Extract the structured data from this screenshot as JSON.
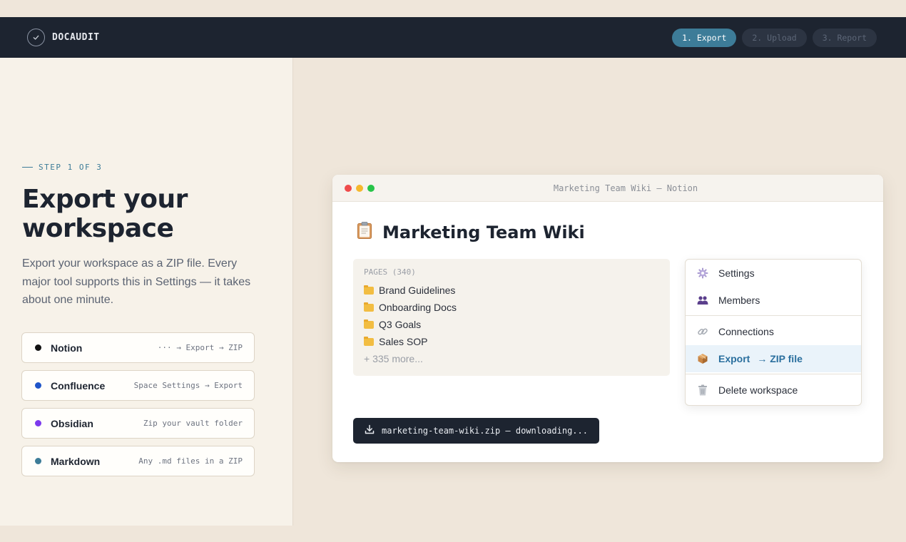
{
  "header": {
    "brand": "DOCAUDIT",
    "steps": [
      {
        "label": "1. Export",
        "active": true
      },
      {
        "label": "2. Upload",
        "active": false
      },
      {
        "label": "3. Report",
        "active": false
      }
    ]
  },
  "intro": {
    "eyebrow": "STEP 1 OF 3",
    "title": "Export your workspace",
    "description": "Export your workspace as a ZIP file. Every major tool supports this in Settings — it takes about one minute."
  },
  "tools": [
    {
      "name": "Notion",
      "path": "··· → Export → ZIP",
      "color": "#111111"
    },
    {
      "name": "Confluence",
      "path": "Space Settings → Export",
      "color": "#1f55c9"
    },
    {
      "name": "Obsidian",
      "path": "Zip your vault folder",
      "color": "#7c3aed"
    },
    {
      "name": "Markdown",
      "path": "Any .md files in a ZIP",
      "color": "#3d7c98"
    }
  ],
  "window": {
    "title": "Marketing Team Wiki — Notion",
    "page_title": "Marketing Team Wiki",
    "page_icon": "clipboard-icon",
    "pages_label": "PAGES (340)",
    "pages": [
      "Brand Guidelines",
      "Onboarding Docs",
      "Q3 Goals",
      "Sales SOP"
    ],
    "more": "+ 335 more...",
    "menu": {
      "settings": "Settings",
      "members": "Members",
      "connections": "Connections",
      "export": "Export",
      "export_hint": "→ ZIP file",
      "delete": "Delete workspace"
    },
    "toast": "marketing-team-wiki.zip — downloading..."
  },
  "colors": {
    "accent": "#3d7c98",
    "dark": "#1d2430",
    "traffic": [
      "#ef4b4b",
      "#f5b82e",
      "#27c449"
    ]
  }
}
